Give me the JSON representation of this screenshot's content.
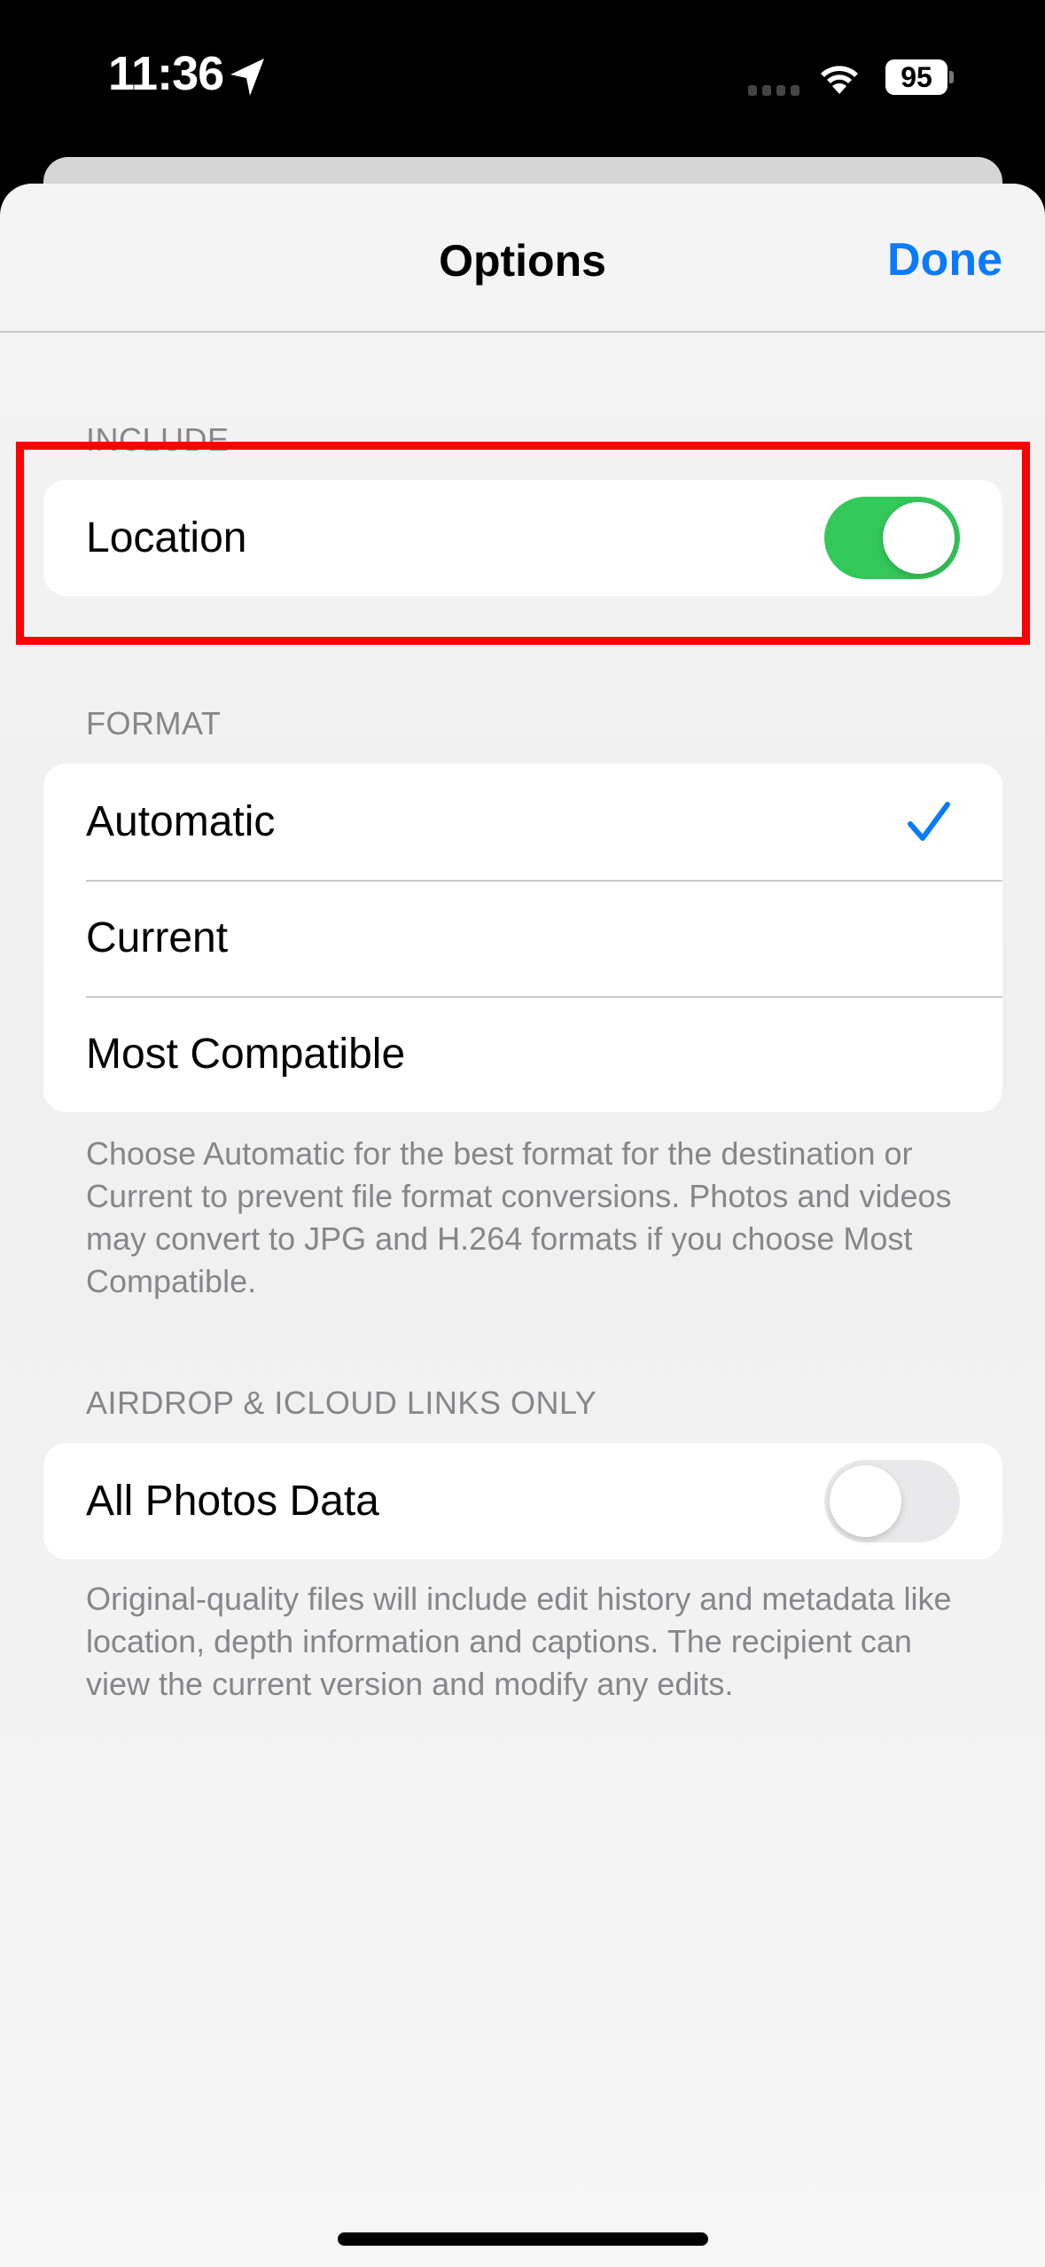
{
  "status_bar": {
    "time": "11:36",
    "location_icon": "location-arrow-icon",
    "signal_icon": "cellular-signal-icon",
    "wifi_icon": "wifi-icon",
    "battery_level": "95"
  },
  "nav": {
    "title": "Options",
    "done_label": "Done"
  },
  "sections": {
    "include": {
      "header": "INCLUDE",
      "rows": [
        {
          "label": "Location",
          "toggle_on": true
        }
      ]
    },
    "format": {
      "header": "FORMAT",
      "options": [
        {
          "label": "Automatic",
          "selected": true
        },
        {
          "label": "Current",
          "selected": false
        },
        {
          "label": "Most Compatible",
          "selected": false
        }
      ],
      "footer": "Choose Automatic for the best format for the destination or Current to prevent file format conversions. Photos and videos may convert to JPG and H.264 formats if you choose Most Compatible."
    },
    "airdrop": {
      "header": "AIRDROP & ICLOUD LINKS ONLY",
      "rows": [
        {
          "label": "All Photos Data",
          "toggle_on": false
        }
      ],
      "footer": "Original-quality files will include edit history and metadata like location, depth information and captions. The recipient can view the current version and modify any edits."
    }
  },
  "colors": {
    "accent": "#0a7aff",
    "toggle_on": "#34c759",
    "toggle_off": "#e9e9eb",
    "highlight": "#ff0000",
    "secondary_text": "#86868b"
  }
}
